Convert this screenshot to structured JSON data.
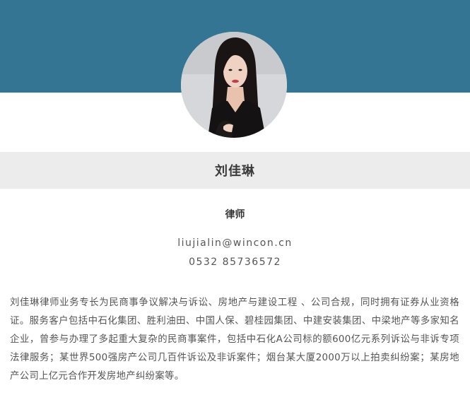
{
  "profile": {
    "name": "刘佳琳",
    "title": "律师",
    "email": "liujialin@wincon.cn",
    "phone": "0532 85736572",
    "bio": "刘佳琳律师业务专长为民商事争议解决与诉讼、房地产与建设工程 、公司合规，同时拥有证券从业资格证。服务客户包括中石化集团、胜利油田、中国人保、碧桂园集团、中建安装集团、中梁地产等多家知名企业，曾参与办理了多起重大复杂的民商事案件，包括中石化A公司标的额600亿元系列诉讼与非诉专项法律服务；某世界500强房产公司几百件诉讼及非诉案件；烟台某大厦2000万以上拍卖纠纷案；某房地产公司上亿元合作开发房地产纠纷案等。"
  },
  "colors": {
    "banner": "#357594",
    "name_band": "#ececec",
    "text": "#555555"
  },
  "icons": {
    "avatar": "portrait-photo"
  }
}
